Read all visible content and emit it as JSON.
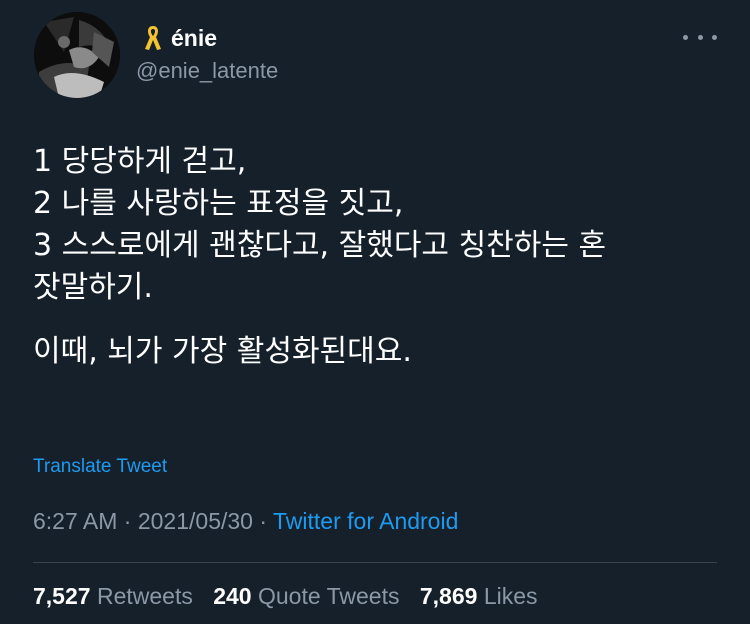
{
  "author": {
    "display_name": "énie",
    "handle": "@enie_latente",
    "ribbon_color": "#f4c430"
  },
  "tweet": {
    "lines": [
      "1 당당하게 걷고,",
      "2 나를 사랑하는 표정을 짓고,",
      "3 스스로에게 괜찮다고, 잘했다고 칭찬하는 혼",
      "잣말하기."
    ],
    "second_paragraph": "이때, 뇌가 가장 활성화된대요.",
    "translate_label": "Translate Tweet"
  },
  "meta": {
    "time": "6:27 AM",
    "date": "2021/05/30",
    "separator": "·",
    "source": "Twitter for Android"
  },
  "stats": {
    "retweets_count": "7,527",
    "retweets_label": "Retweets",
    "quotes_count": "240",
    "quotes_label": "Quote Tweets",
    "likes_count": "7,869",
    "likes_label": "Likes"
  },
  "icons": {
    "more": "more-icon",
    "ribbon": "yellow-ribbon-icon"
  },
  "colors": {
    "background": "#15202b",
    "accent": "#1d9bf0",
    "secondary_text": "#8b98a5"
  }
}
